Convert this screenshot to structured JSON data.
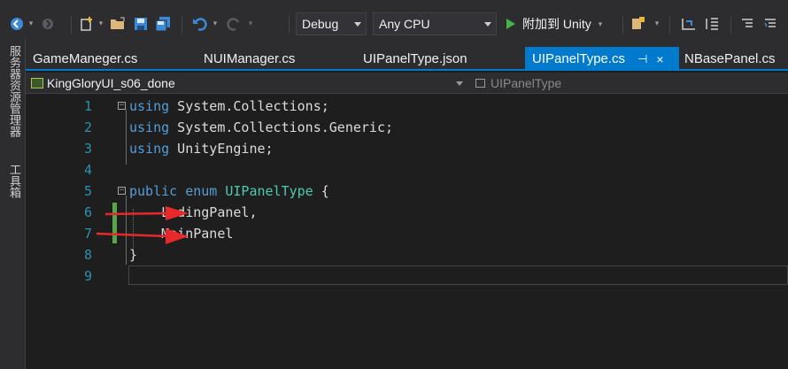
{
  "toolbar": {
    "config_value": "Debug",
    "platform_value": "Any CPU",
    "attach_label": "附加到 Unity"
  },
  "side_panel": {
    "server_explorer": "服务器资源管理器",
    "toolbox": "工具箱"
  },
  "tabs": [
    {
      "label": "GameManeger.cs",
      "active": false
    },
    {
      "label": "NUIManager.cs",
      "active": false
    },
    {
      "label": "UIPanelType.json",
      "active": false
    },
    {
      "label": "UIPanelType.cs",
      "active": true,
      "pin": "⊣",
      "close": "×"
    },
    {
      "label": "NBasePanel.cs",
      "active": false
    }
  ],
  "navbar": {
    "project": "KingGloryUI_s06_done",
    "type": "UIPanelType"
  },
  "editor": {
    "lines": [
      {
        "n": "1",
        "kw": "using",
        "text": " System.Collections;"
      },
      {
        "n": "2",
        "kw": "using",
        "text": " System.Collections.Generic;"
      },
      {
        "n": "3",
        "kw": "using",
        "text": " UnityEngine;"
      },
      {
        "n": "4",
        "text": ""
      },
      {
        "n": "5",
        "kw": "public enum",
        "ty": "UIPanelType",
        "text": " {"
      },
      {
        "n": "6",
        "text": "    LodingPanel,"
      },
      {
        "n": "7",
        "text": "    MainPanel"
      },
      {
        "n": "8",
        "text": "}"
      },
      {
        "n": "9",
        "text": ""
      }
    ]
  },
  "colors": {
    "accent": "#007acc",
    "keyword": "#569cd6",
    "type": "#4ec9b0",
    "line_number": "#2b91af",
    "annotation_arrow": "#e8292b"
  }
}
